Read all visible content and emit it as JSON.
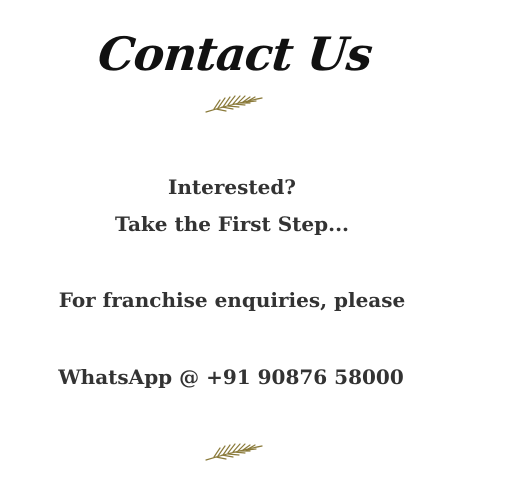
{
  "contact": {
    "title": "Contact Us",
    "line1": "Interested?",
    "line2": "Take the First Step...",
    "line3": "For franchise enquiries, please",
    "line4": "WhatsApp @ +91 90876 58000"
  },
  "icons": {
    "top_divider": "palm-leaf-icon",
    "bottom_divider": "palm-leaf-icon"
  },
  "colors": {
    "text": "#333333",
    "title": "#111111",
    "leaf": "#8a7a3a",
    "background": "#ffffff"
  }
}
